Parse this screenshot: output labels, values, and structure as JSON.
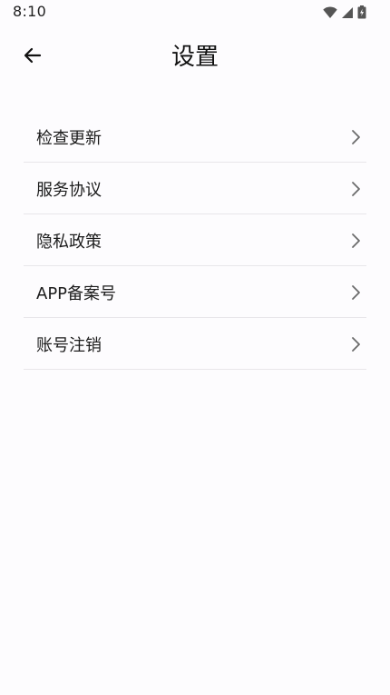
{
  "status_bar": {
    "time": "8:10",
    "icons": [
      "wifi-icon",
      "cellular-signal-icon",
      "battery-icon"
    ]
  },
  "header": {
    "title": "设置",
    "back_icon": "arrow-left-icon"
  },
  "settings": {
    "items": [
      {
        "label": "检查更新",
        "icon": "chevron-right-icon"
      },
      {
        "label": "服务协议",
        "icon": "chevron-right-icon"
      },
      {
        "label": "隐私政策",
        "icon": "chevron-right-icon"
      },
      {
        "label": "APP备案号",
        "icon": "chevron-right-icon"
      },
      {
        "label": "账号注销",
        "icon": "chevron-right-icon"
      }
    ]
  },
  "colors": {
    "background": "#fdfcfe",
    "text": "#1c1c1c",
    "divider": "#e8e6ea",
    "chevron": "#6b6b6b"
  }
}
